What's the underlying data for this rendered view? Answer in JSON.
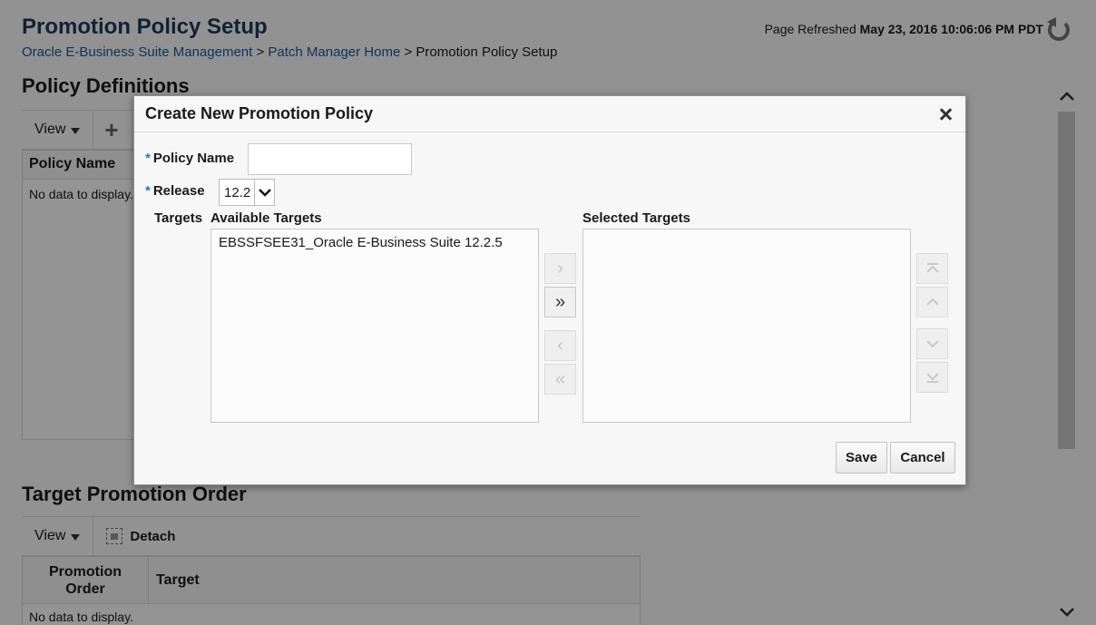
{
  "page": {
    "title": "Promotion Policy Setup",
    "breadcrumb": {
      "link1": "Oracle E-Business Suite Management",
      "sep1": " > ",
      "link2": "Patch Manager Home",
      "sep2": " > ",
      "current": "Promotion Policy Setup"
    },
    "refreshed_label": "Page Refreshed",
    "refreshed_value": "May 23, 2016 10:06:06 PM PDT"
  },
  "policy_definitions": {
    "title": "Policy Definitions",
    "view_label": "View",
    "column_policy_name": "Policy Name",
    "no_data": "No data to display."
  },
  "target_promotion_order": {
    "title": "Target Promotion Order",
    "view_label": "View",
    "detach_label": "Detach",
    "column_promotion_order_line1": "Promotion",
    "column_promotion_order_line2": "Order",
    "column_target": "Target",
    "no_data": "No data to display."
  },
  "dialog": {
    "title": "Create New Promotion Policy",
    "required_mark": "*",
    "policy_name_label": "Policy Name",
    "policy_name_value": "",
    "release_label": "Release",
    "release_value": "12.2",
    "targets_label": "Targets",
    "available_targets_label": "Available Targets",
    "selected_targets_label": "Selected Targets",
    "available_targets": [
      "EBSSFSEE31_Oracle E-Business Suite 12.2.5"
    ],
    "selected_targets": [],
    "move_label": "›",
    "move_all_label": "»",
    "remove_label": "‹",
    "remove_all_label": "«",
    "save_label": "Save",
    "cancel_label": "Cancel"
  }
}
